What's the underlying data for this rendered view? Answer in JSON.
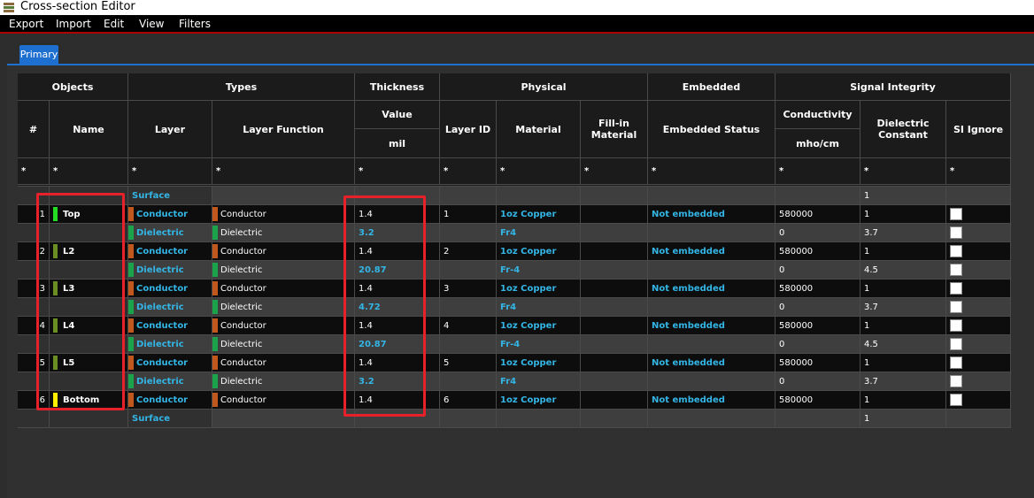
{
  "window": {
    "title": "Cross-section Editor",
    "icon": "stack-icon"
  },
  "menu": [
    "Export",
    "Import",
    "Edit",
    "View",
    "Filters"
  ],
  "tabs": [
    {
      "label": "Primary",
      "active": true
    }
  ],
  "header": {
    "groups": {
      "objects": "Objects",
      "types": "Types",
      "thickness": "Thickness",
      "physical": "Physical",
      "embedded": "Embedded",
      "si": "Signal Integrity"
    },
    "cols": {
      "num": "#",
      "name": "Name",
      "layer": "Layer",
      "layer_function": "Layer Function",
      "value": "Value",
      "unit": "mil",
      "layer_id": "Layer ID",
      "material": "Material",
      "fill": "Fill-in Material",
      "embedded_status": "Embedded Status",
      "conductivity": "Conductivity",
      "cond_unit": "mho/cm",
      "dielectric_constant": "Dielectric Constant",
      "si_ignore": "SI Ignore"
    },
    "filter": "*"
  },
  "colors": {
    "conductor": "#c0581e",
    "dielectric": "#1aa34a",
    "accent": "#33b5e5",
    "annotation": "#e8202a"
  },
  "rows": [
    {
      "kind": "surface",
      "layer": "Surface",
      "dk": "1"
    },
    {
      "kind": "conductor",
      "num": "1",
      "name": "Top",
      "swatch": "#22dd22",
      "layer": "Conductor",
      "func": "Conductor",
      "thickness": "1.4",
      "layer_id": "1",
      "material": "1oz Copper",
      "embedded": "Not embedded",
      "cond": "580000",
      "dk": "1"
    },
    {
      "kind": "dielectric",
      "layer": "Dielectric",
      "func": "Dielectric",
      "thickness": "3.2",
      "material": "Fr4",
      "cond": "0",
      "dk": "3.7"
    },
    {
      "kind": "conductor",
      "num": "2",
      "name": "L2",
      "swatch": "#6b8e23",
      "layer": "Conductor",
      "func": "Conductor",
      "thickness": "1.4",
      "layer_id": "2",
      "material": "1oz Copper",
      "embedded": "Not embedded",
      "cond": "580000",
      "dk": "1"
    },
    {
      "kind": "dielectric",
      "layer": "Dielectric",
      "func": "Dielectric",
      "thickness": "20.87",
      "material": "Fr-4",
      "cond": "0",
      "dk": "4.5"
    },
    {
      "kind": "conductor",
      "num": "3",
      "name": "L3",
      "swatch": "#6b8e23",
      "layer": "Conductor",
      "func": "Conductor",
      "thickness": "1.4",
      "layer_id": "3",
      "material": "1oz Copper",
      "embedded": "Not embedded",
      "cond": "580000",
      "dk": "1"
    },
    {
      "kind": "dielectric",
      "layer": "Dielectric",
      "func": "Dielectric",
      "thickness": "4.72",
      "material": "Fr4",
      "cond": "0",
      "dk": "3.7"
    },
    {
      "kind": "conductor",
      "num": "4",
      "name": "L4",
      "swatch": "#6b8e23",
      "layer": "Conductor",
      "func": "Conductor",
      "thickness": "1.4",
      "layer_id": "4",
      "material": "1oz Copper",
      "embedded": "Not embedded",
      "cond": "580000",
      "dk": "1"
    },
    {
      "kind": "dielectric",
      "layer": "Dielectric",
      "func": "Dielectric",
      "thickness": "20.87",
      "material": "Fr-4",
      "cond": "0",
      "dk": "4.5"
    },
    {
      "kind": "conductor",
      "num": "5",
      "name": "L5",
      "swatch": "#6b8e23",
      "layer": "Conductor",
      "func": "Conductor",
      "thickness": "1.4",
      "layer_id": "5",
      "material": "1oz Copper",
      "embedded": "Not embedded",
      "cond": "580000",
      "dk": "1"
    },
    {
      "kind": "dielectric",
      "layer": "Dielectric",
      "func": "Dielectric",
      "thickness": "3.2",
      "material": "Fr4",
      "cond": "0",
      "dk": "3.7"
    },
    {
      "kind": "conductor",
      "num": "6",
      "name": "Bottom",
      "swatch": "#ffee00",
      "layer": "Conductor",
      "func": "Conductor",
      "thickness": "1.4",
      "layer_id": "6",
      "material": "1oz Copper",
      "embedded": "Not embedded",
      "cond": "580000",
      "dk": "1"
    },
    {
      "kind": "surface",
      "layer": "Surface",
      "dk": "1"
    }
  ]
}
